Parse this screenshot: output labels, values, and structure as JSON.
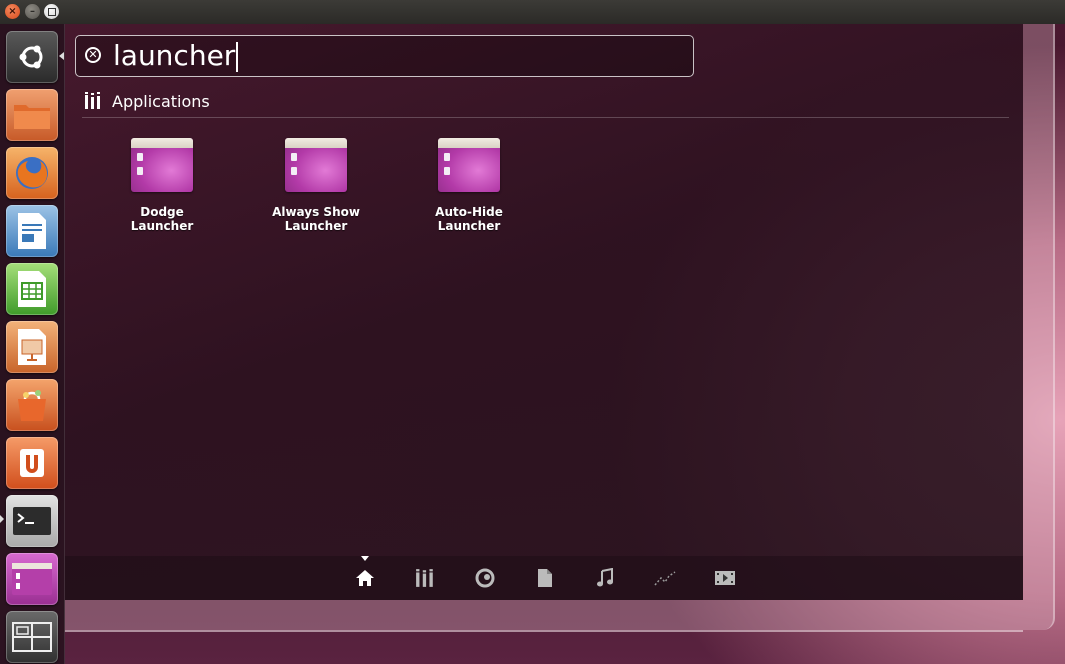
{
  "window": {
    "close_glyph": "×",
    "minimize_glyph": "–"
  },
  "search": {
    "value": "launcher",
    "clear_glyph": "✕"
  },
  "category": {
    "title": "Applications",
    "icon": "applications-lens-icon"
  },
  "apps": [
    {
      "label": "Dodge\nLauncher",
      "icon": "compiz-settings-icon"
    },
    {
      "label": "Always Show\nLauncher",
      "icon": "compiz-settings-icon"
    },
    {
      "label": "Auto-Hide\nLauncher",
      "icon": "compiz-settings-icon"
    }
  ],
  "launcher": {
    "items": [
      {
        "name": "dash-home",
        "icon": "ubuntu-logo-icon",
        "active": true
      },
      {
        "name": "home-folder",
        "icon": "folder-icon"
      },
      {
        "name": "firefox",
        "icon": "firefox-icon"
      },
      {
        "name": "libreoffice-writer",
        "icon": "writer-icon"
      },
      {
        "name": "libreoffice-calc",
        "icon": "calc-icon"
      },
      {
        "name": "libreoffice-impress",
        "icon": "impress-icon"
      },
      {
        "name": "software-center",
        "icon": "software-center-icon"
      },
      {
        "name": "ubuntu-one",
        "icon": "ubuntu-one-icon"
      },
      {
        "name": "terminal",
        "icon": "terminal-icon",
        "running": true
      },
      {
        "name": "compiz-config",
        "icon": "compiz-settings-icon"
      },
      {
        "name": "workspace-switcher",
        "icon": "workspace-switcher-icon"
      }
    ]
  },
  "lenses": [
    {
      "name": "home",
      "icon": "home-icon",
      "active": true
    },
    {
      "name": "applications",
      "icon": "applications-lens-icon"
    },
    {
      "name": "gwibber",
      "icon": "gwibber-icon"
    },
    {
      "name": "files",
      "icon": "file-icon"
    },
    {
      "name": "music",
      "icon": "music-icon"
    },
    {
      "name": "photos",
      "icon": "photo-icon"
    },
    {
      "name": "video",
      "icon": "video-icon"
    }
  ],
  "colors": {
    "accent": "#b33aa8",
    "close_button": "#e05a2a"
  }
}
